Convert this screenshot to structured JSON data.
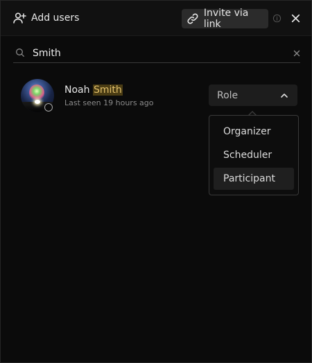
{
  "header": {
    "title": "Add users",
    "invite_label": "Invite via link"
  },
  "search": {
    "value": "Smith",
    "placeholder": ""
  },
  "user": {
    "first_name": "Noah",
    "last_name_match": "Smith",
    "last_seen": "Last seen 19 hours ago"
  },
  "role": {
    "label": "Role",
    "options": [
      "Organizer",
      "Scheduler",
      "Participant"
    ],
    "hovered": "Participant"
  },
  "icons": {
    "title": "add-user-icon",
    "invite": "link-icon",
    "info": "info-icon",
    "close": "close-icon",
    "search": "search-icon",
    "clear": "clear-icon",
    "chevron": "chevron-up-icon"
  },
  "colors": {
    "background": "#0b0b0b",
    "header": "#111111",
    "highlight_bg": "#4a3c14",
    "highlight_text": "#e2c06a",
    "menu_hover": "#1f1f1f"
  }
}
